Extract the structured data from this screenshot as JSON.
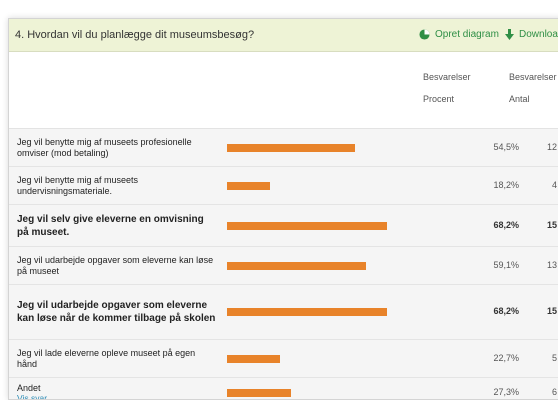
{
  "question": {
    "title": "4. Hvordan vil du planlægge dit museumsbesøg?"
  },
  "actions": {
    "diagram_label": "Opret diagram",
    "download_label": "Download"
  },
  "headers": {
    "col1_line1": "Besvarelser",
    "col1_line2": "Procent",
    "col2_line1": "Besvarelser",
    "col2_line2": "Antal"
  },
  "rows": [
    {
      "label": "Jeg vil benytte mig af museets profesionelle omviser (mod betaling)",
      "percent": "54,5%",
      "count": "12",
      "fraction": 0.545,
      "bold": false
    },
    {
      "label": "Jeg vil benytte mig af museets undervisningsmateriale.",
      "percent": "18,2%",
      "count": "4",
      "fraction": 0.182,
      "bold": false
    },
    {
      "label": "Jeg vil selv give eleverne en omvisning på museet.",
      "percent": "68,2%",
      "count": "15",
      "fraction": 0.682,
      "bold": true
    },
    {
      "label": "Jeg vil udarbejde opgaver som eleverne kan løse på museet",
      "percent": "59,1%",
      "count": "13",
      "fraction": 0.591,
      "bold": false
    },
    {
      "label": "Jeg vil udarbejde opgaver som eleverne kan løse når de kommer tilbage på skolen",
      "percent": "68,2%",
      "count": "15",
      "fraction": 0.682,
      "bold": true
    },
    {
      "label": "Jeg vil lade eleverne opleve museet på egen hånd",
      "percent": "22,7%",
      "count": "5",
      "fraction": 0.227,
      "bold": false
    },
    {
      "label": "Andet",
      "link": "Vis svar",
      "percent": "27,3%",
      "count": "6",
      "fraction": 0.273,
      "bold": false
    }
  ],
  "colors": {
    "bar": "#e8832a",
    "header_bg": "#eef3d6",
    "accent": "#2f8f46",
    "link": "#2a8bb5"
  }
}
